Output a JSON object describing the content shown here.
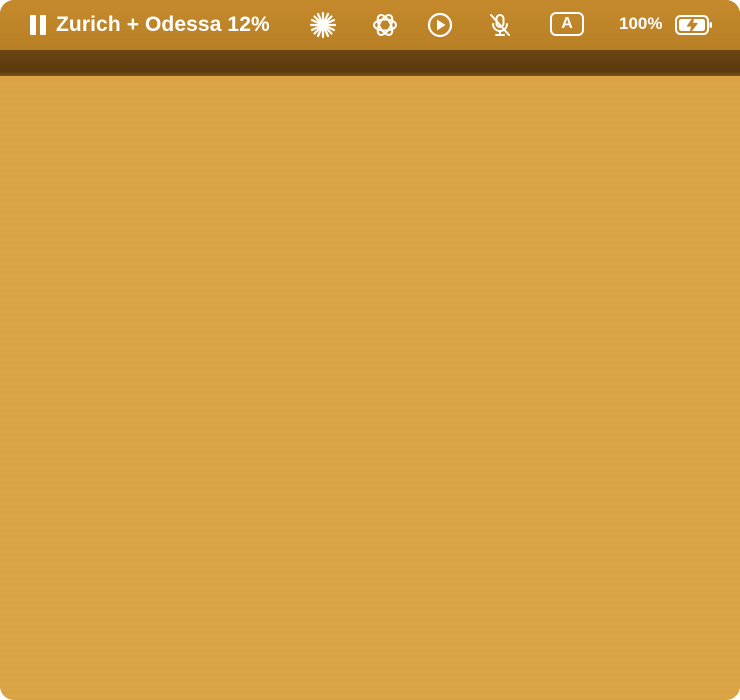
{
  "menubar": {
    "timer": {
      "label": "Zurich + Odessa 12%"
    },
    "icons": [
      "pause-icon",
      "sparkle-icon",
      "chatgpt-icon",
      "play-icon",
      "mute-icon",
      "input-source-icon",
      "battery-icon"
    ],
    "input_source": "A",
    "battery": {
      "percent_label": "100%",
      "level": 1.0,
      "charging": true
    }
  },
  "colors": {
    "menubar": "#c08628",
    "band": "#5a3a0d",
    "desktop": "#dba445",
    "foreground": "#ffffff"
  }
}
